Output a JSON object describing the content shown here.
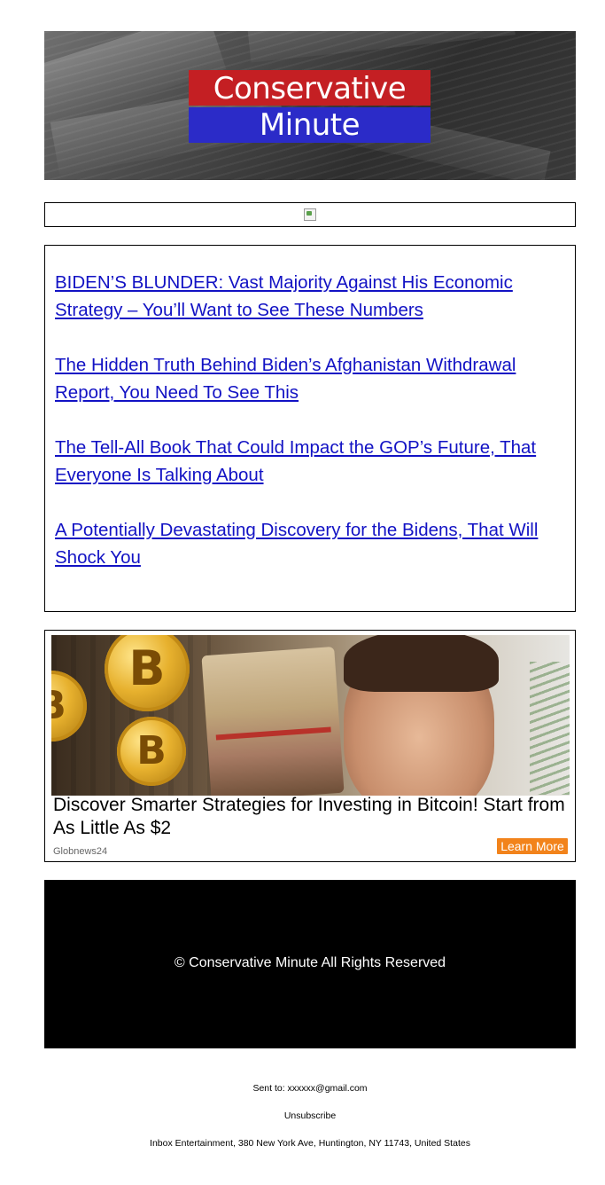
{
  "header": {
    "logo_top": "Conservative",
    "logo_bottom": "Minute",
    "colors": {
      "logo_red": "#c41f23",
      "logo_blue": "#2b2bc8"
    }
  },
  "headlines": [
    {
      "text": "BIDEN’S BLUNDER: Vast Majority Against His Economic Strategy – You’ll Want to See These Numbers"
    },
    {
      "text": "The Hidden Truth Behind Biden’s Afghanistan Withdrawal Report, You Need To See This"
    },
    {
      "text": "The Tell-All Book That Could Impact the GOP’s Future, That Everyone Is Talking About"
    },
    {
      "text": "A Potentially Devastating Discovery for the Bidens, That Will Shock You"
    }
  ],
  "ad": {
    "title": "Discover Smarter Strategies for Investing in Bitcoin! Start from As Little As $2",
    "source": "Globnews24",
    "cta": "Learn More",
    "coin_symbol": "B",
    "cta_color": "#f2831b"
  },
  "footer": {
    "copyright": "© Conservative Minute All Rights Reserved",
    "sent_to": "Sent to: xxxxxx@gmail.com",
    "unsubscribe": "Unsubscribe",
    "address": "Inbox Entertainment, 380 New York Ave, Huntington, NY 11743, United States"
  }
}
